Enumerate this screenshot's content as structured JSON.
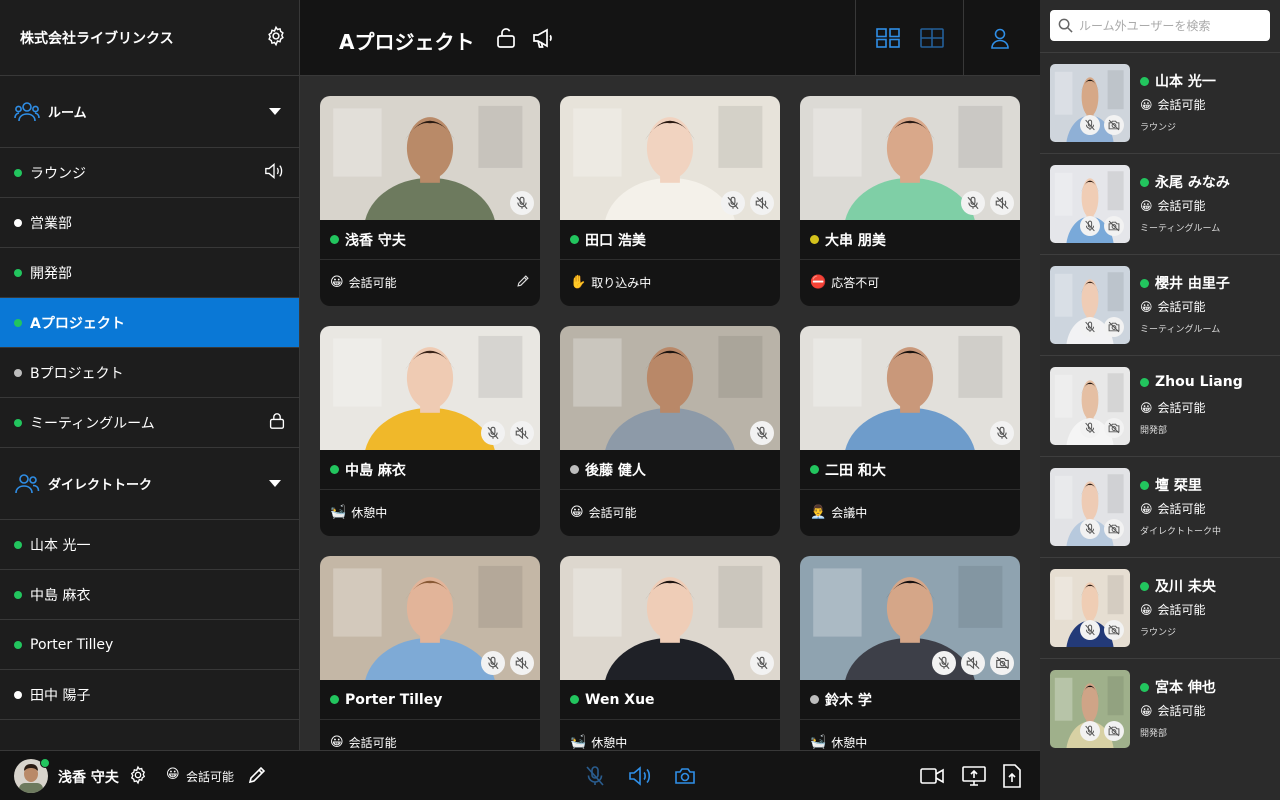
{
  "sidebar": {
    "org_name": "株式会社ライブリンクス",
    "rooms_label": "ルーム",
    "rooms": [
      {
        "label": "ラウンジ",
        "dot": "#22c55e",
        "icon": "speaker-icon"
      },
      {
        "label": "営業部",
        "dot": "#ffffff"
      },
      {
        "label": "開発部",
        "dot": "#22c55e"
      },
      {
        "label": "Aプロジェクト",
        "dot": "#22c55e",
        "active": true
      },
      {
        "label": "Bプロジェクト",
        "dot": "#bdbdbd"
      },
      {
        "label": "ミーティングルーム",
        "dot": "#22c55e",
        "icon": "lock-icon"
      }
    ],
    "direct_label": "ダイレクトトーク",
    "direct": [
      {
        "label": "山本 光一",
        "dot": "#22c55e"
      },
      {
        "label": "中島 麻衣",
        "dot": "#22c55e"
      },
      {
        "label": "Porter Tilley",
        "dot": "#22c55e"
      },
      {
        "label": "田中 陽子",
        "dot": "#ffffff"
      }
    ]
  },
  "header": {
    "title": "Aプロジェクト"
  },
  "cards": [
    {
      "name": "浅香 守夫",
      "dot": "#22c55e",
      "emoji": "😀",
      "status": "会話可能",
      "edit": true,
      "skin": "#b98a68",
      "hair": "#2a1b12",
      "shirt": "#6d7a5e",
      "bg": "#d8d4cc",
      "badges": [
        "mic-off"
      ]
    },
    {
      "name": "田口 浩美",
      "dot": "#22c55e",
      "emoji": "✋",
      "status": "取り込み中",
      "skin": "#f1d3c0",
      "hair": "#2b1a12",
      "shirt": "#f4f1ea",
      "bg": "#e7e3da",
      "badges": [
        "mic-off",
        "speaker-off"
      ]
    },
    {
      "name": "大串 朋美",
      "dot": "#d4c21c",
      "emoji": "⛔",
      "status": "応答不可",
      "skin": "#d9a88a",
      "hair": "#2a1a14",
      "shirt": "#7fcfa6",
      "bg": "#dcdad5",
      "badges": [
        "mic-off",
        "speaker-off"
      ]
    },
    {
      "name": "中島 麻衣",
      "dot": "#22c55e",
      "emoji": "🛀",
      "status": "休憩中",
      "skin": "#efcbb3",
      "hair": "#3a2418",
      "shirt": "#f0b82a",
      "bg": "#e9e7e2",
      "badges": [
        "mic-off",
        "speaker-off"
      ]
    },
    {
      "name": "後藤 健人",
      "dot": "#bdbdbd",
      "emoji": "😀",
      "status": "会話可能",
      "skin": "#b98868",
      "hair": "#1c1410",
      "shirt": "#8d9aa8",
      "bg": "#b9b3a8",
      "badges": [
        "mic-off"
      ]
    },
    {
      "name": "二田 和大",
      "dot": "#22c55e",
      "emoji": "👨‍💼",
      "status": "会議中",
      "skin": "#c9987a",
      "hair": "#1a120e",
      "shirt": "#6e9ccb",
      "bg": "#e2e0db",
      "badges": [
        "mic-off"
      ]
    },
    {
      "name": "Porter Tilley",
      "dot": "#22c55e",
      "emoji": "😀",
      "status": "会話可能",
      "skin": "#e2b499",
      "hair": "#8a5a36",
      "shirt": "#7eaad6",
      "bg": "#c4b7a6",
      "badges": [
        "mic-off",
        "speaker-off"
      ]
    },
    {
      "name": "Wen Xue",
      "dot": "#22c55e",
      "emoji": "🛀",
      "status": "休憩中",
      "skin": "#efcdb7",
      "hair": "#1e1410",
      "shirt": "#1f2127",
      "bg": "#ddd7ce",
      "badges": [
        "mic-off"
      ]
    },
    {
      "name": "鈴木 学",
      "dot": "#bdbdbd",
      "emoji": "🛀",
      "status": "休憩中",
      "skin": "#d5a688",
      "hair": "#161010",
      "shirt": "#3d3f48",
      "bg": "#8fa3b0",
      "badges": [
        "mic-off",
        "speaker-off",
        "camera-off"
      ]
    }
  ],
  "search": {
    "placeholder": "ルーム外ユーザーを検索"
  },
  "room_users": [
    {
      "name": "山本 光一",
      "emoji": "😀",
      "status": "会話可能",
      "location": "ラウンジ",
      "skin": "#d6a887",
      "hair": "#1c1410",
      "shirt": "#8fb0d6",
      "bg": "#cfd5dc"
    },
    {
      "name": "永尾 みなみ",
      "emoji": "😀",
      "status": "会話可能",
      "location": "ミーティングルーム",
      "skin": "#f0cdb5",
      "hair": "#2a1a12",
      "shirt": "#79a9d9",
      "bg": "#e5e6ea"
    },
    {
      "name": "櫻井 由里子",
      "emoji": "😀",
      "status": "会話可能",
      "location": "ミーティングルーム",
      "skin": "#efccb5",
      "hair": "#3a2418",
      "shirt": "#f2f2f4",
      "bg": "#cdd5de"
    },
    {
      "name": "Zhou Liang",
      "emoji": "😀",
      "status": "会話可能",
      "location": "開発部",
      "skin": "#e5bfa3",
      "hair": "#1a120e",
      "shirt": "#f5f5f5",
      "bg": "#e8e8e8"
    },
    {
      "name": "壇 栞里",
      "emoji": "😀",
      "status": "会話可能",
      "location": "ダイレクトトーク中",
      "skin": "#eecbb4",
      "hair": "#2a1a12",
      "shirt": "#b7c9dd",
      "bg": "#e2e3e6"
    },
    {
      "name": "及川 未央",
      "emoji": "😀",
      "status": "会話可能",
      "location": "ラウンジ",
      "skin": "#efcdb4",
      "hair": "#2b1a12",
      "shirt": "#233a78",
      "bg": "#e6ded2"
    },
    {
      "name": "宮本 伸也",
      "emoji": "😀",
      "status": "会話可能",
      "location": "開発部",
      "skin": "#cfa487",
      "hair": "#141010",
      "shirt": "#d8d1a4",
      "bg": "#9fb08b"
    }
  ],
  "footer": {
    "user_name": "浅香 守夫",
    "emoji": "😀",
    "status": "会話可能"
  },
  "colors": {
    "accent": "#0a78d6",
    "online": "#22c55e",
    "busy": "#d4c21c"
  }
}
